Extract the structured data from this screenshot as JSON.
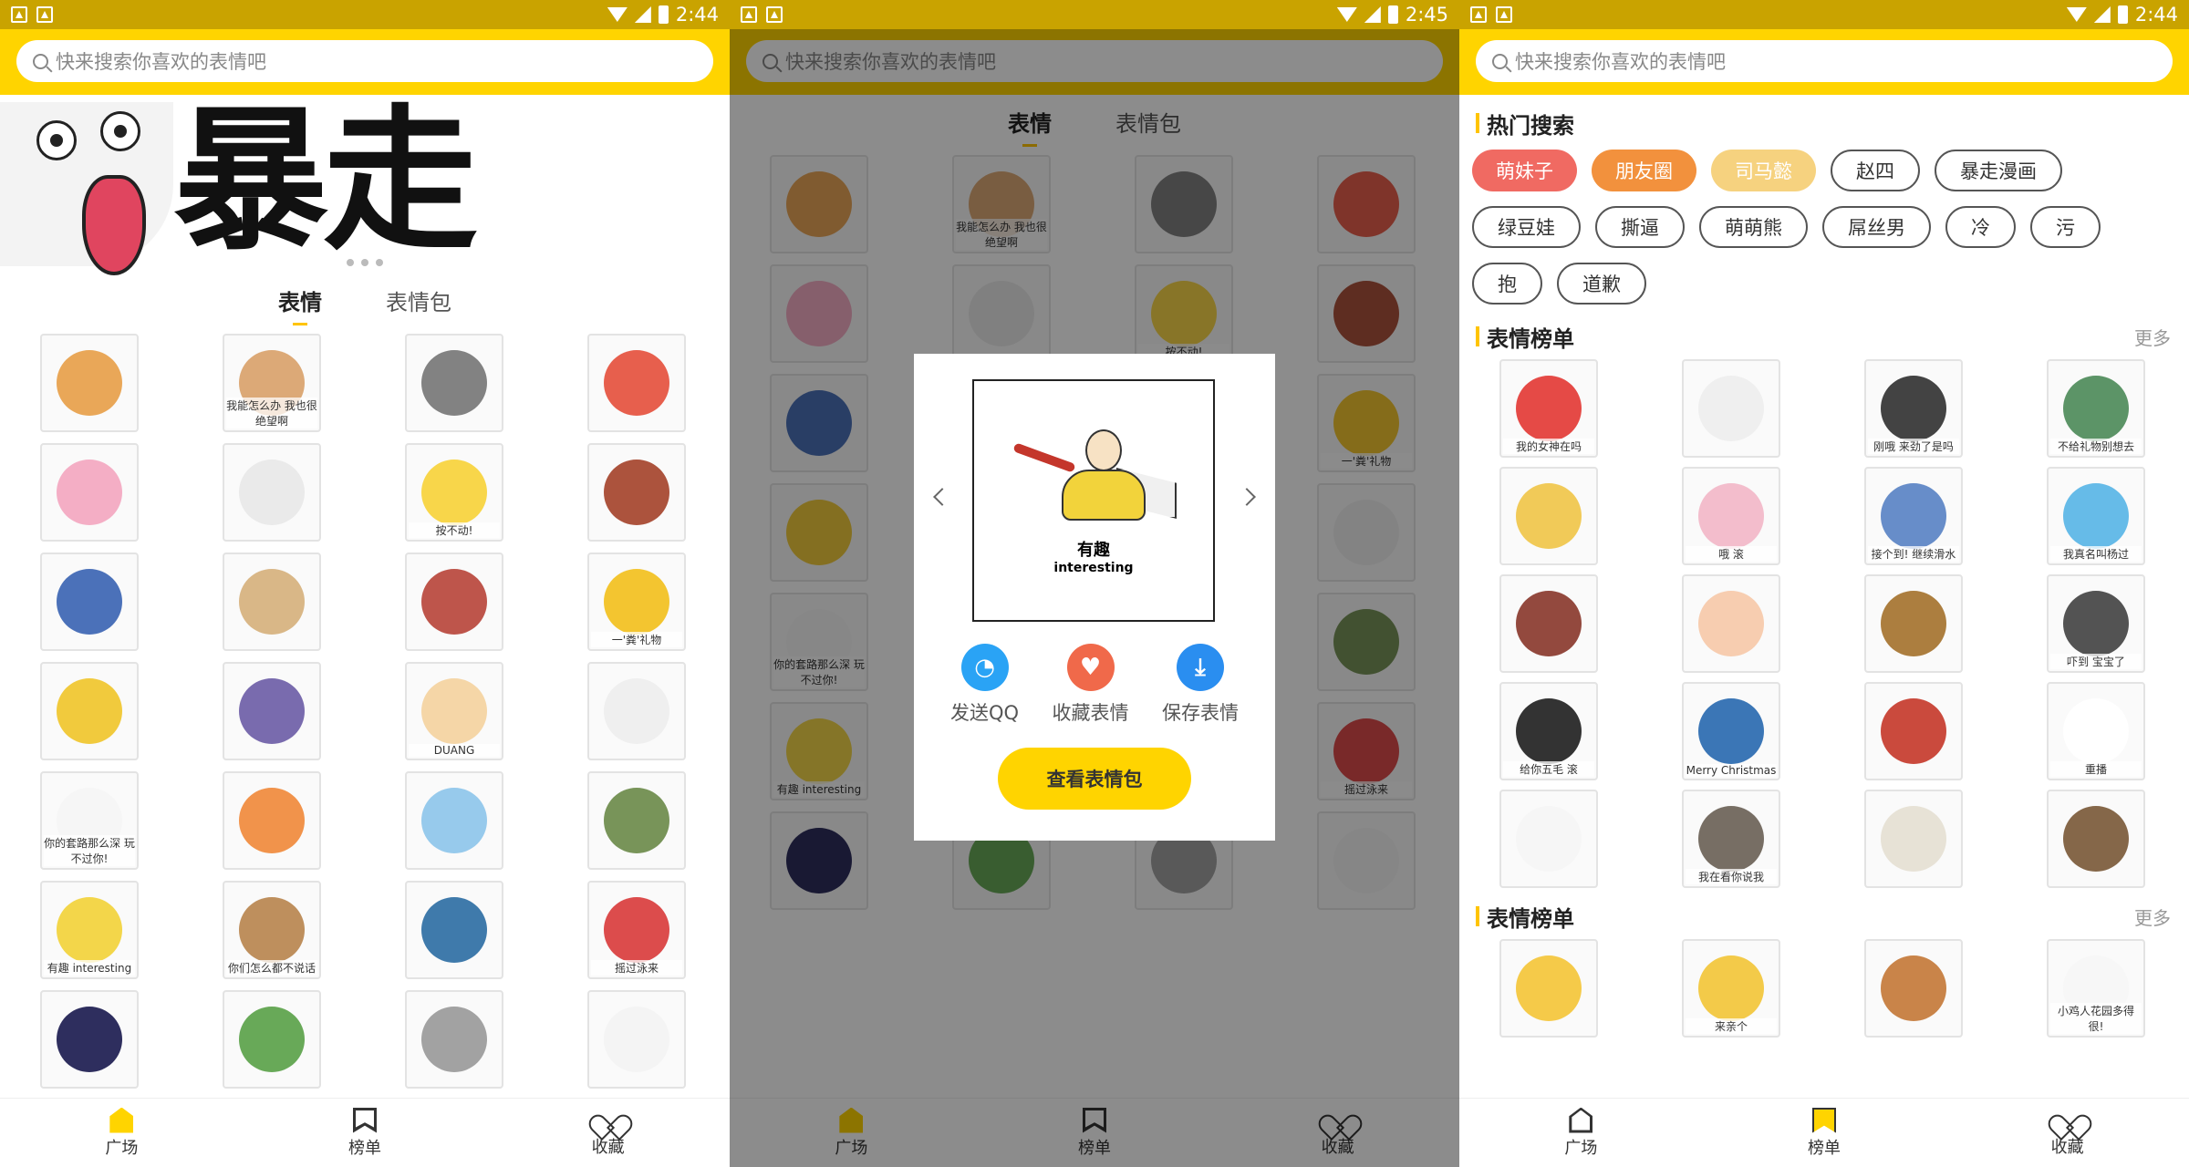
{
  "status_left": {
    "time": "2:44"
  },
  "status_mid": {
    "time": "2:45"
  },
  "status_right": {
    "time": "2:44"
  },
  "search": {
    "placeholder": "快来搜索你喜欢的表情吧"
  },
  "banner": {
    "title": "暴走"
  },
  "tabs": [
    {
      "label": "表情"
    },
    {
      "label": "表情包"
    }
  ],
  "nav": [
    {
      "label": "广场"
    },
    {
      "label": "榜单"
    },
    {
      "label": "收藏"
    }
  ],
  "grid": {
    "rows": [
      [
        {
          "color": "#e7a04a",
          "caption": ""
        },
        {
          "color": "#d9a26b",
          "caption": "我能怎么办 我也很绝望啊"
        },
        {
          "color": "#777777",
          "caption": ""
        },
        {
          "color": "#e5513e",
          "caption": ""
        }
      ],
      [
        {
          "color": "#f3a7c0",
          "caption": ""
        },
        {
          "color": "#e8e8e8",
          "caption": ""
        },
        {
          "color": "#f7d33b",
          "caption": "按不动!"
        },
        {
          "color": "#a5442c",
          "caption": ""
        }
      ],
      [
        {
          "color": "#3c65b3",
          "caption": ""
        },
        {
          "color": "#d6b17d",
          "caption": ""
        },
        {
          "color": "#b8473c",
          "caption": ""
        },
        {
          "color": "#f2c01e",
          "caption": "一'粪'礼物"
        }
      ],
      [
        {
          "color": "#f0c52d",
          "caption": ""
        },
        {
          "color": "#6e5ea7",
          "caption": ""
        },
        {
          "color": "#f4d2a0",
          "caption": "DUANG"
        },
        {
          "color": "#eeeeee",
          "caption": ""
        }
      ],
      [
        {
          "color": "#f5f5f5",
          "caption": "你的套路那么深 玩不过你!"
        },
        {
          "color": "#f08a3c",
          "caption": ""
        },
        {
          "color": "#8ec6ea",
          "caption": ""
        },
        {
          "color": "#6c8b4b",
          "caption": ""
        }
      ],
      [
        {
          "color": "#f2d33b",
          "caption": "有趣 interesting"
        },
        {
          "color": "#b8864f",
          "caption": "你们怎么都不说话"
        },
        {
          "color": "#2f6fa4",
          "caption": ""
        },
        {
          "color": "#d93d3d",
          "caption": "摇过泳来"
        }
      ],
      [
        {
          "color": "#1c1c50",
          "caption": ""
        },
        {
          "color": "#5ba24a",
          "caption": ""
        },
        {
          "color": "#9a9a9a",
          "caption": ""
        },
        {
          "color": "#f3f3f3",
          "caption": ""
        }
      ]
    ]
  },
  "dialog": {
    "preview_cn": "有趣",
    "preview_en": "interesting",
    "actions": [
      {
        "label": "发送QQ",
        "icon": "qq-icon",
        "color": "#2aa3f5"
      },
      {
        "label": "收藏表情",
        "icon": "heart-icon",
        "color": "#f0694a"
      },
      {
        "label": "保存表情",
        "icon": "download-icon",
        "color": "#2a8ef0"
      }
    ],
    "view_button": "查看表情包"
  },
  "hot_search": {
    "title": "热门搜索",
    "tags": [
      {
        "label": "萌妹子",
        "color": "#f06a62"
      },
      {
        "label": "朋友圈",
        "color": "#f2913d"
      },
      {
        "label": "司马懿",
        "color": "#f6d27f"
      },
      {
        "label": "赵四",
        "color": ""
      },
      {
        "label": "暴走漫画",
        "color": ""
      },
      {
        "label": "绿豆娃",
        "color": ""
      },
      {
        "label": "撕逼",
        "color": ""
      },
      {
        "label": "萌萌熊",
        "color": ""
      },
      {
        "label": "屌丝男",
        "color": ""
      },
      {
        "label": "冷",
        "color": ""
      },
      {
        "label": "污",
        "color": ""
      },
      {
        "label": "抱",
        "color": ""
      },
      {
        "label": "道歉",
        "color": ""
      }
    ]
  },
  "rank1": {
    "title": "表情榜单",
    "more": "更多",
    "rows": [
      [
        {
          "color": "#e33b36",
          "caption": "我的女神在吗"
        },
        {
          "color": "#eeeeee",
          "caption": ""
        },
        {
          "color": "#333333",
          "caption": "刚哦 来劲了是吗"
        },
        {
          "color": "#4e8b5a",
          "caption": "不给礼物别想去"
        }
      ],
      [
        {
          "color": "#f0c64a",
          "caption": ""
        },
        {
          "color": "#f2b7c8",
          "caption": "哦 滚"
        },
        {
          "color": "#5a83c4",
          "caption": "接个到! 继续滑水"
        },
        {
          "color": "#59b5e6",
          "caption": "我真名叫杨过"
        }
      ],
      [
        {
          "color": "#8a3a2e",
          "caption": ""
        },
        {
          "color": "#f6c9a9",
          "caption": ""
        },
        {
          "color": "#a5732f",
          "caption": ""
        },
        {
          "color": "#444444",
          "caption": "吓到 宝宝了"
        }
      ],
      [
        {
          "color": "#222222",
          "caption": "给你五毛 滚"
        },
        {
          "color": "#2a6ab0",
          "caption": "Merry Christmas"
        },
        {
          "color": "#c53b2c",
          "caption": ""
        },
        {
          "color": "#ffffff",
          "caption": "重播"
        }
      ],
      [
        {
          "color": "#f5f5f5",
          "caption": ""
        },
        {
          "color": "#6b6257",
          "caption": "我在看你说我"
        },
        {
          "color": "#e5e0d2",
          "caption": ""
        },
        {
          "color": "#7b5a3a",
          "caption": ""
        }
      ]
    ]
  },
  "rank2": {
    "title": "表情榜单",
    "more": "更多",
    "rows": [
      [
        {
          "color": "#f4c63a",
          "caption": ""
        },
        {
          "color": "#f2c53a",
          "caption": "来亲个"
        },
        {
          "color": "#c47a3a",
          "caption": ""
        },
        {
          "color": "#f6f6f6",
          "caption": "小鸡人花园多得很!"
        }
      ]
    ]
  }
}
